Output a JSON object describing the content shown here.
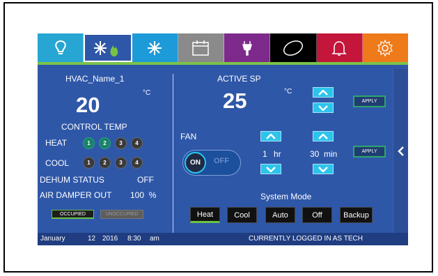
{
  "tabs": [
    {
      "icon": "lightbulb-icon",
      "color": "#27a6d3"
    },
    {
      "icon": "heat-cool-icon",
      "color": "#2f57a8"
    },
    {
      "icon": "snowflake-icon",
      "color": "#1d9bd8"
    },
    {
      "icon": "calendar-icon",
      "color": "#8a8a8a"
    },
    {
      "icon": "plug-icon",
      "color": "#7e2a8c"
    },
    {
      "icon": "ellipse-icon",
      "color": "#000000"
    },
    {
      "icon": "bell-icon",
      "color": "#c4153a"
    },
    {
      "icon": "gear-icon",
      "color": "#ee7a1a"
    }
  ],
  "left": {
    "hvac_name": "HVAC_Name_1",
    "temp_value": "20",
    "temp_unit": "°C",
    "control_temp_label": "CONTROL TEMP",
    "heat_label": "HEAT",
    "heat_stages": [
      "1",
      "2",
      "3",
      "4"
    ],
    "cool_label": "COOL",
    "cool_stages": [
      "1",
      "2",
      "3",
      "4"
    ],
    "dehum_label": "DEHUM STATUS",
    "dehum_value": "OFF",
    "damper_label": "AIR DAMPER OUT",
    "damper_value": "100  %",
    "occupied_label": "OCCUPIED",
    "unoccupied_label": "UNOCCUPIED"
  },
  "right": {
    "active_sp_label": "ACTIVE SP",
    "sp_value": "25",
    "sp_unit": "°C",
    "apply_label": "APPLY",
    "fan_label": "FAN",
    "fan_on": "ON",
    "fan_off": "OFF",
    "hours_value": "1",
    "hours_unit": "hr",
    "minutes_value": "30",
    "minutes_unit": "min",
    "system_mode_label": "System Mode",
    "modes": [
      "Heat",
      "Cool",
      "Auto",
      "Off",
      "Backup"
    ],
    "active_mode": "Heat"
  },
  "status": {
    "date_month": "January",
    "date_day": "12",
    "date_year": "2016",
    "time": "8:30",
    "ampm": "am",
    "login_text": "CURRENTLY LOGGED IN AS TECH"
  },
  "side_arrow": "chevron-left-icon"
}
